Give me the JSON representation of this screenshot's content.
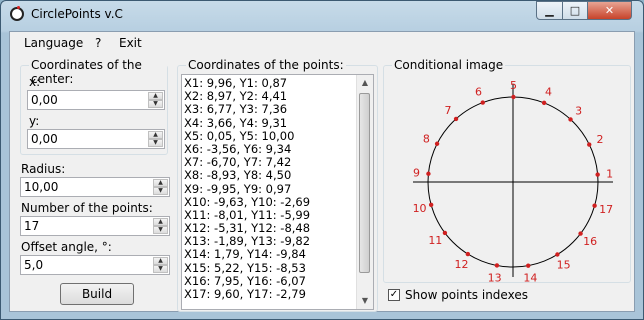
{
  "window": {
    "title": "CirclePoints v.C",
    "min_glyph": "▁",
    "max_glyph": "□",
    "close_glyph": "✕"
  },
  "menu": [
    "Language",
    "?",
    "Exit"
  ],
  "center_group": {
    "label": "Coordinates of the center:",
    "x_label": "x:",
    "x_value": "0,00",
    "y_label": "y:",
    "y_value": "0,00"
  },
  "radius": {
    "label": "Radius:",
    "value": "10,00"
  },
  "num_points": {
    "label": "Number of the points:",
    "value": "17"
  },
  "offset": {
    "label": "Offset angle, °:",
    "value": "5,0"
  },
  "build_label": "Build",
  "points_list": {
    "label": "Coordinates of the points:",
    "lines": [
      "X1: 9,96, Y1: 0,87",
      "X2: 8,97, Y2: 4,41",
      "X3: 6,77, Y3: 7,36",
      "X4: 3,66, Y4: 9,31",
      "X5: 0,05, Y5: 10,00",
      "X6: -3,56, Y6: 9,34",
      "X7: -6,70, Y7: 7,42",
      "X8: -8,93, Y8: 4,50",
      "X9: -9,95, Y9: 0,97",
      "X10: -9,63, Y10: -2,69",
      "X11: -8,01, Y11: -5,99",
      "X12: -5,31, Y12: -8,48",
      "X13: -1,89, Y13: -9,82",
      "X14: 1,79, Y14: -9,84",
      "X15: 5,22, Y15: -8,53",
      "X16: 7,95, Y16: -6,07",
      "X17: 9,60, Y17: -2,79"
    ]
  },
  "image": {
    "label": "Conditional image",
    "points": [
      {
        "x": 9.96,
        "y": 0.87,
        "label": "1"
      },
      {
        "x": 8.97,
        "y": 4.41,
        "label": "2"
      },
      {
        "x": 6.77,
        "y": 7.36,
        "label": "3"
      },
      {
        "x": 3.66,
        "y": 9.31,
        "label": "4"
      },
      {
        "x": 0.05,
        "y": 10.0,
        "label": "5"
      },
      {
        "x": -3.56,
        "y": 9.34,
        "label": "6"
      },
      {
        "x": -6.7,
        "y": 7.42,
        "label": "7"
      },
      {
        "x": -8.93,
        "y": 4.5,
        "label": "8"
      },
      {
        "x": -9.95,
        "y": 0.97,
        "label": "9"
      },
      {
        "x": -9.63,
        "y": -2.69,
        "label": "10"
      },
      {
        "x": -8.01,
        "y": -5.99,
        "label": "11"
      },
      {
        "x": -5.31,
        "y": -8.48,
        "label": "12"
      },
      {
        "x": -1.89,
        "y": -9.82,
        "label": "13"
      },
      {
        "x": 1.79,
        "y": -9.84,
        "label": "14"
      },
      {
        "x": 5.22,
        "y": -8.53,
        "label": "15"
      },
      {
        "x": 7.95,
        "y": -6.07,
        "label": "16"
      },
      {
        "x": 9.6,
        "y": -2.79,
        "label": "17"
      }
    ],
    "radius": 10,
    "point_color": "#d02020"
  },
  "show_indexes": {
    "label": "Show points indexes",
    "checked": true,
    "glyph": "✓"
  }
}
